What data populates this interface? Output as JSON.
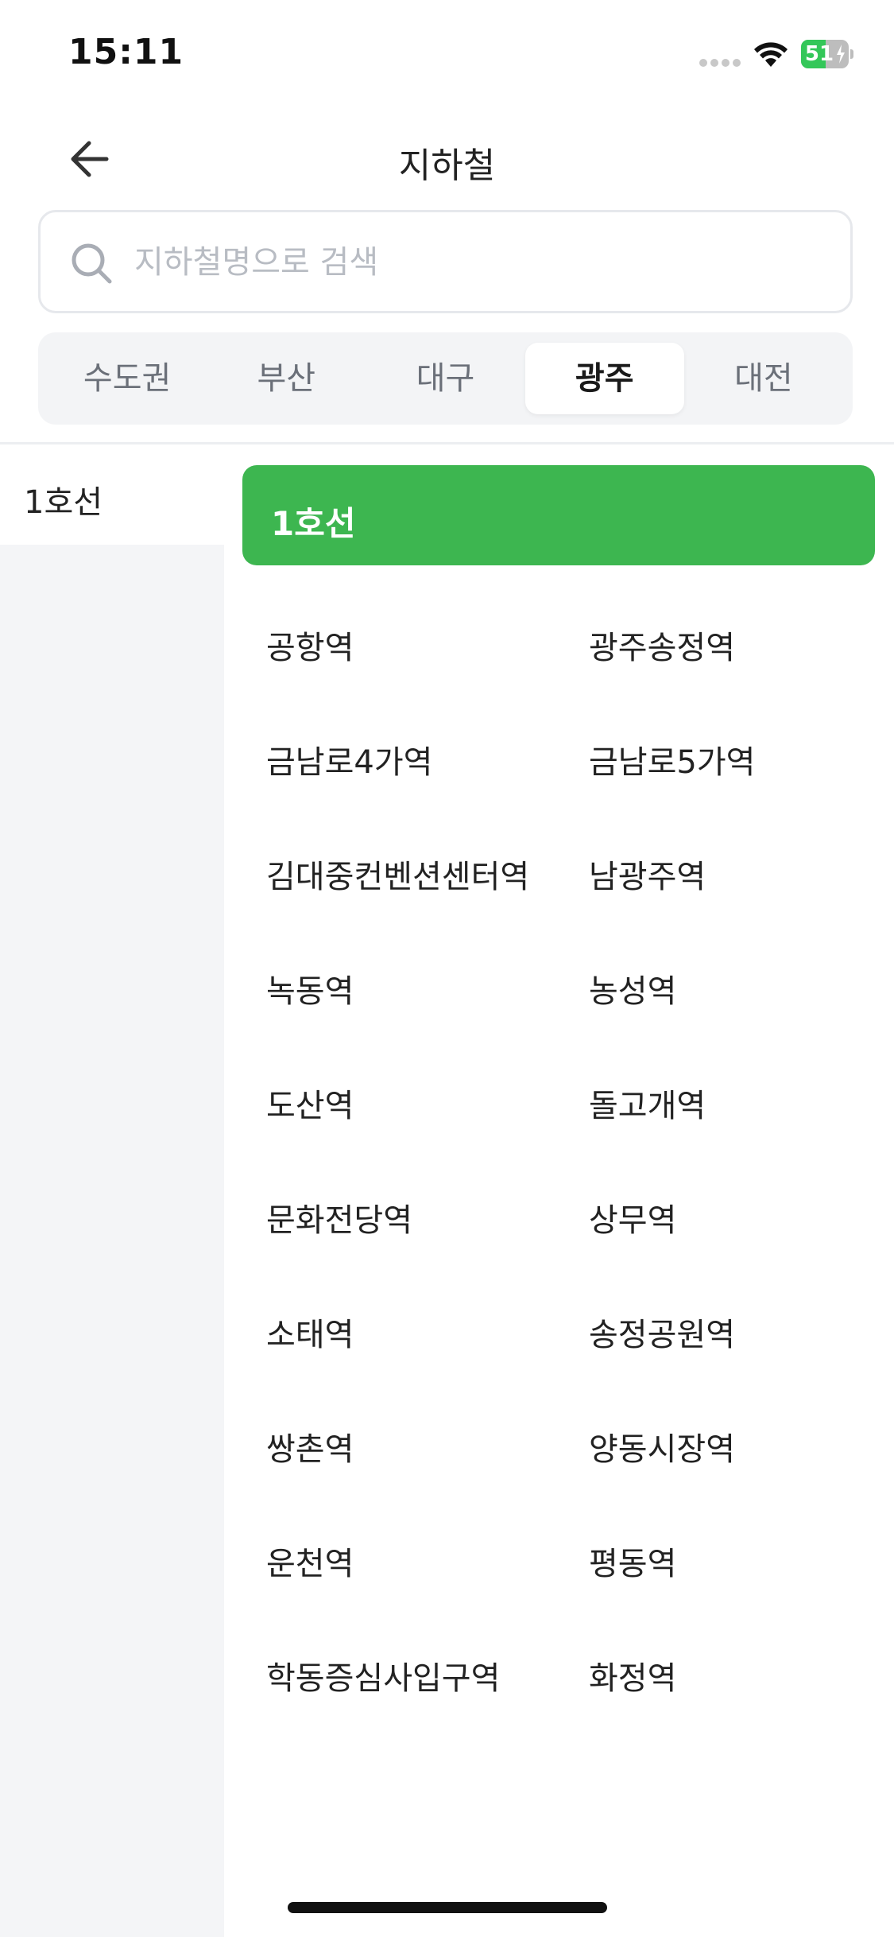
{
  "status_bar": {
    "time": "15:11",
    "battery_level": "51",
    "battery_fraction": 0.51,
    "battery_color": "#34c759",
    "icons": [
      "signal-dots-icon",
      "wifi-icon",
      "battery-charging-icon"
    ]
  },
  "header": {
    "title": "지하철",
    "back_icon": "arrow-left-icon"
  },
  "search": {
    "placeholder": "지하철명으로 검색",
    "value": "",
    "icon": "search-icon"
  },
  "region_tabs": [
    {
      "label": "수도권",
      "active": false
    },
    {
      "label": "부산",
      "active": false
    },
    {
      "label": "대구",
      "active": false
    },
    {
      "label": "광주",
      "active": true
    },
    {
      "label": "대전",
      "active": false
    }
  ],
  "line_sidebar": {
    "items": [
      {
        "label": "1호선",
        "selected": true
      }
    ]
  },
  "line_header": {
    "label": "1호선",
    "color": "#3db650"
  },
  "stations": [
    "공항역",
    "광주송정역",
    "금남로4가역",
    "금남로5가역",
    "김대중컨벤션센터역",
    "남광주역",
    "녹동역",
    "농성역",
    "도산역",
    "돌고개역",
    "문화전당역",
    "상무역",
    "소태역",
    "송정공원역",
    "쌍촌역",
    "양동시장역",
    "운천역",
    "평동역",
    "학동증심사입구역",
    "화정역"
  ]
}
